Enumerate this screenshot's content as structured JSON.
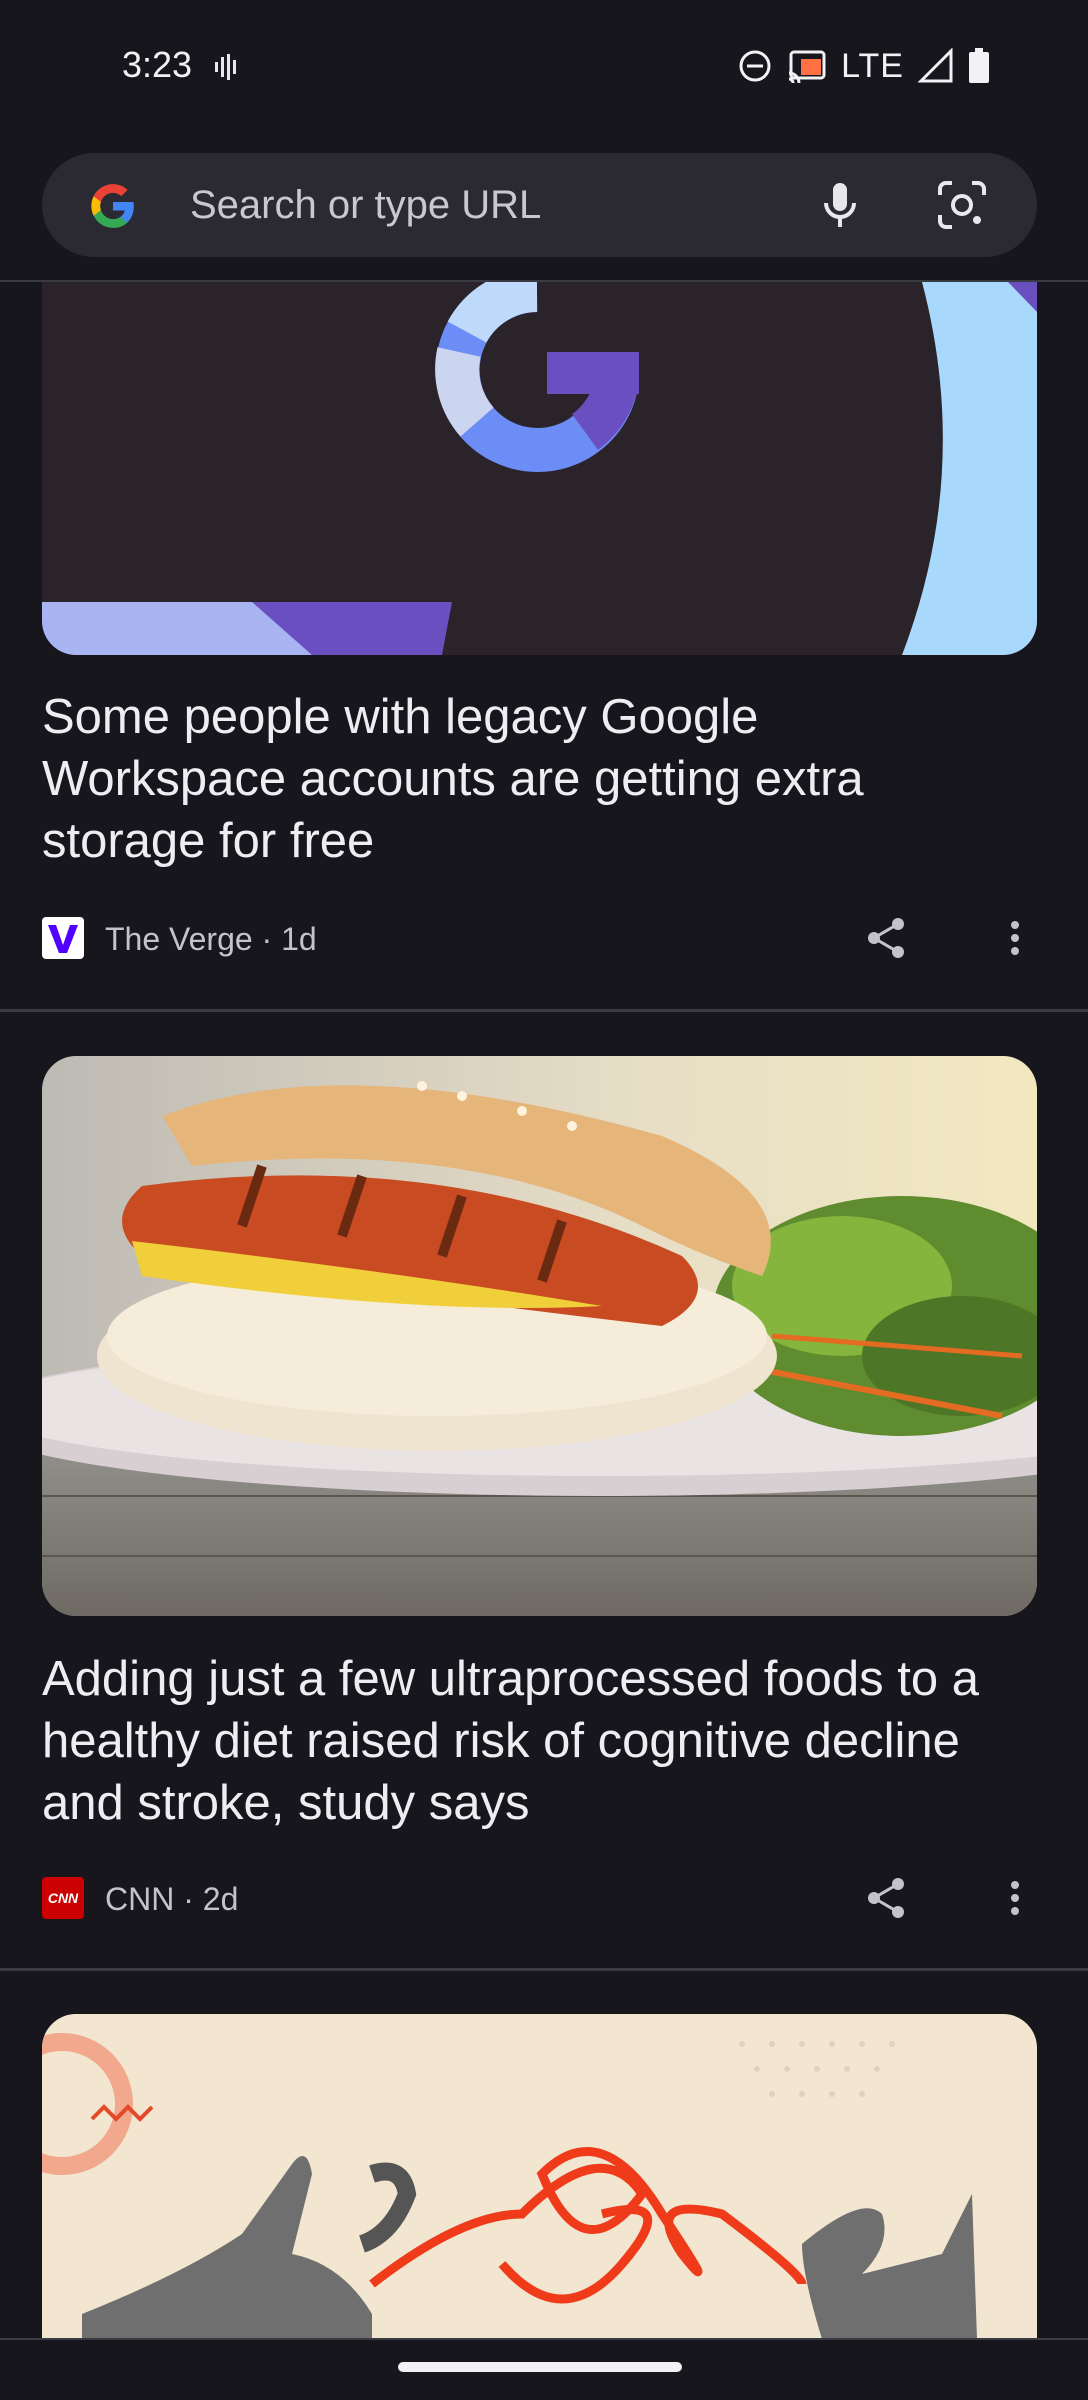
{
  "status_bar": {
    "time": "3:23",
    "network": "LTE",
    "icons": [
      "vibrate-icon",
      "do-not-disturb-icon",
      "cast-icon",
      "signal-icon",
      "battery-icon"
    ]
  },
  "search": {
    "placeholder": "Search or type URL",
    "icons": [
      "google-logo",
      "mic-icon",
      "google-lens-icon"
    ]
  },
  "feed": {
    "articles": [
      {
        "headline": "Some people with legacy Google Workspace accounts are getting extra storage for free",
        "source_line": "The Verge · 1d",
        "source_logo": "verge-logo"
      },
      {
        "headline": "Adding just a few ultraprocessed foods to a healthy diet raised risk of cognitive decline and stroke, study says",
        "source_line": "CNN · 2d",
        "source_logo": "cnn-logo",
        "logo_text": "CNN"
      }
    ]
  },
  "colors": {
    "background": "#16161c",
    "search_bar": "#2b2a33",
    "text": "#eeeef2",
    "muted": "#c4c3cb"
  }
}
